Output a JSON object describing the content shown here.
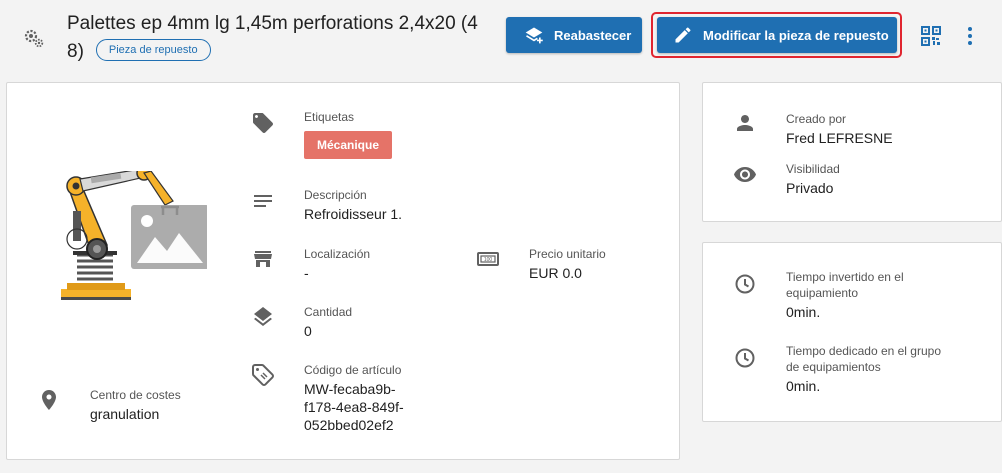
{
  "header": {
    "title": "Palettes ep 4mm lg 1,45m perforations 2,4x20 (4 8)",
    "badge": "Pieza de repuesto",
    "restock_label": "Reabastecer",
    "edit_label": "Modificar la pieza de repuesto"
  },
  "main": {
    "labels": {
      "title": "Etiquetas",
      "chip": "Mécanique"
    },
    "description": {
      "label": "Descripción",
      "value": "Refroidisseur 1."
    },
    "location": {
      "label": "Localización",
      "value": "-"
    },
    "unit_price": {
      "label": "Precio unitario",
      "value": "EUR 0.0"
    },
    "quantity": {
      "label": "Cantidad",
      "value": "0"
    },
    "article_code": {
      "label": "Código de artículo",
      "value_line1": "MW-fecaba9b-",
      "value_line2": "f178-4ea8-849f-",
      "value_line3": "052bbed02ef2"
    },
    "cost_center": {
      "label": "Centro de costes",
      "value": "granulation"
    }
  },
  "creator": {
    "created_by": {
      "label": "Creado por",
      "value": "Fred LEFRESNE"
    },
    "visibility": {
      "label": "Visibilidad",
      "value": "Privado"
    }
  },
  "time": {
    "equipment": {
      "label_line1": "Tiempo invertido en el",
      "label_line2": "equipamiento",
      "value": "0min."
    },
    "group": {
      "label_line1": "Tiempo dedicado en el grupo",
      "label_line2": "de equipamientos",
      "value": "0min."
    }
  },
  "colors": {
    "primary": "#1f6fb2",
    "highlight": "#e0252f",
    "chip": "#e57368",
    "icon": "#616161"
  },
  "icons": [
    "gear-icon",
    "layers-add-icon",
    "pencil-icon",
    "qr-code-icon",
    "more-vert-icon",
    "tag-icon",
    "description-icon",
    "store-icon",
    "money-icon",
    "layers-icon",
    "barcode-tag-icon",
    "location-pin-icon",
    "person-icon",
    "eye-icon",
    "clock-icon"
  ]
}
